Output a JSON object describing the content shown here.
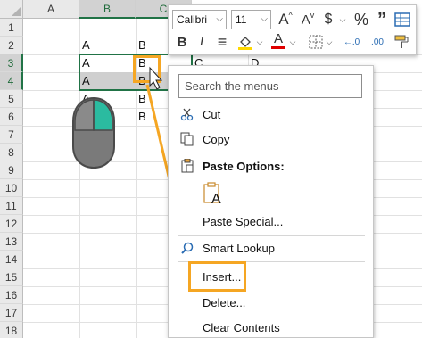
{
  "columns": [
    "A",
    "B",
    "C"
  ],
  "rows": [
    "1",
    "2",
    "3",
    "4",
    "5",
    "6",
    "7",
    "8",
    "9",
    "10",
    "11",
    "12",
    "13",
    "14",
    "15",
    "16",
    "17",
    "18"
  ],
  "cells": {
    "r2a": "A",
    "r2b": "B",
    "r3a": "A",
    "r3b": "B",
    "r3c": "C",
    "r3d": "D",
    "r4a": "A",
    "r4b": "B",
    "r5a": "A",
    "r5b": "B",
    "r6b": "B"
  },
  "minibar": {
    "font_name": "Calibri",
    "font_size": "11",
    "grow_font": "A",
    "shrink_font": "A",
    "currency": "$",
    "percent": "%",
    "comma": "”",
    "bold": "B",
    "italic": "I",
    "align": "≡",
    "font_color_letter": "A",
    "decimal_inc": "←.0",
    "decimal_dec": ".00"
  },
  "menu": {
    "search_placeholder": "Search the menus",
    "items": [
      {
        "label": "Cut",
        "icon": "scissors-icon"
      },
      {
        "label": "Copy",
        "icon": "copy-icon"
      },
      {
        "label": "Paste Options:",
        "icon": "paste-icon"
      },
      {
        "label": "Paste Special...",
        "icon": ""
      },
      {
        "label": "Smart Lookup",
        "icon": "search-icon"
      },
      {
        "label": "Insert...",
        "icon": ""
      },
      {
        "label": "Delete...",
        "icon": ""
      },
      {
        "label": "Clear Contents",
        "icon": ""
      }
    ],
    "paste_option_letter": "A"
  },
  "colors": {
    "selection_green": "#217346",
    "highlight_orange": "#f5a623",
    "mouse_button_teal": "#2bbba0",
    "mouse_body": "#7a7a7a"
  }
}
